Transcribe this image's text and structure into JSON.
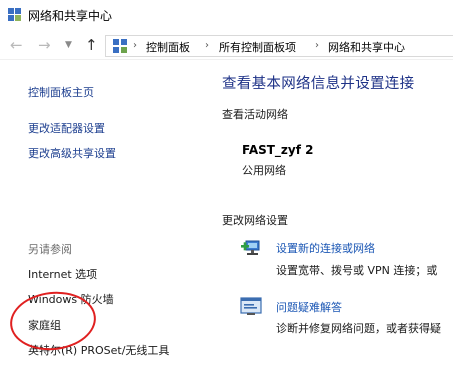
{
  "window": {
    "title": "网络和共享中心",
    "icon": "network-center-icon"
  },
  "nav": {
    "back_icon": "back-arrow-icon",
    "forward_icon": "forward-arrow-icon",
    "recent_icon": "chevron-down-icon",
    "up_icon": "up-arrow-icon"
  },
  "breadcrumb": {
    "items": [
      "控制面板",
      "所有控制面板项",
      "网络和共享中心"
    ],
    "separator": "›"
  },
  "sidebar": {
    "home": "控制面板主页",
    "links": [
      "更改适配器设置",
      "更改高级共享设置"
    ],
    "see_also_label": "另请参阅",
    "see_also": [
      "Internet 选项",
      "Windows 防火墙",
      "家庭组",
      "英特尔(R) PROSet/无线工具"
    ]
  },
  "main": {
    "title": "查看基本网络信息并设置连接",
    "active_section": "查看活动网络",
    "network": {
      "name": "FAST_zyf  2",
      "type": "公用网络"
    },
    "change_section": "更改网络设置",
    "tasks": [
      {
        "icon": "new-connection-icon",
        "link": "设置新的连接或网络",
        "desc": "设置宽带、拨号或 VPN 连接；或"
      },
      {
        "icon": "troubleshoot-icon",
        "link": "问题疑难解答",
        "desc": "诊断并修复网络问题，或者获得疑"
      }
    ]
  },
  "colors": {
    "link": "#1c3e8f",
    "title": "#1e3287",
    "annotation": "#e02020"
  }
}
